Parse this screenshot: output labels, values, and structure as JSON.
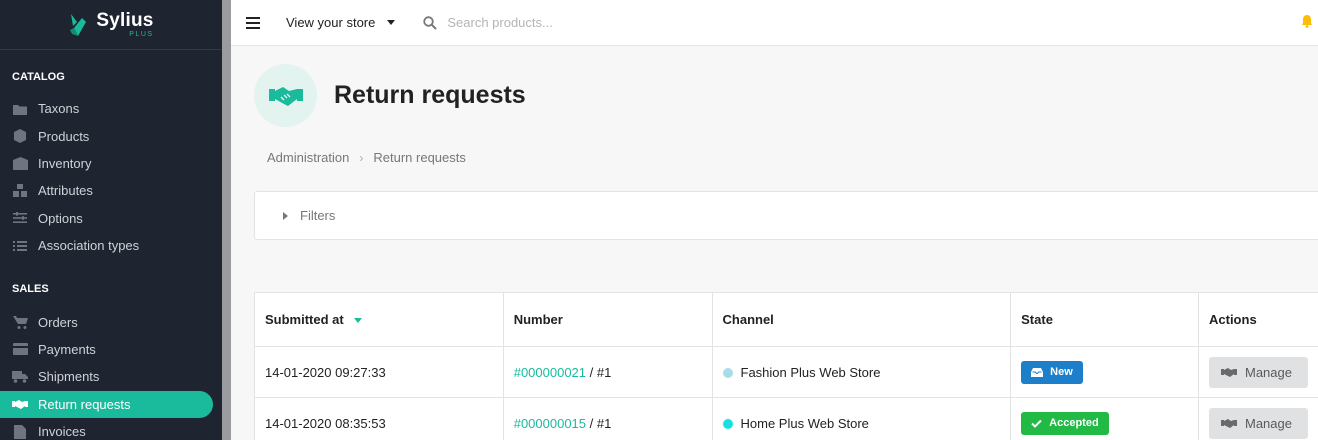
{
  "brand": {
    "name": "Sylius",
    "sub": "PLUS",
    "accent": "#1abb9c"
  },
  "sidebar": {
    "sections": [
      {
        "title": "CATALOG",
        "items": [
          {
            "label": "Taxons",
            "icon": "folder-icon"
          },
          {
            "label": "Products",
            "icon": "cube-icon"
          },
          {
            "label": "Inventory",
            "icon": "inventory-icon"
          },
          {
            "label": "Attributes",
            "icon": "cubes-icon"
          },
          {
            "label": "Options",
            "icon": "options-icon"
          },
          {
            "label": "Association types",
            "icon": "list-icon"
          }
        ]
      },
      {
        "title": "SALES",
        "items": [
          {
            "label": "Orders",
            "icon": "cart-icon"
          },
          {
            "label": "Payments",
            "icon": "payment-icon"
          },
          {
            "label": "Shipments",
            "icon": "truck-icon"
          },
          {
            "label": "Return requests",
            "icon": "handshake-icon",
            "active": true
          },
          {
            "label": "Invoices",
            "icon": "file-icon"
          }
        ]
      }
    ]
  },
  "topbar": {
    "store_label": "View your store",
    "search_placeholder": "Search products..."
  },
  "header": {
    "title": "Return requests",
    "breadcrumb": [
      "Administration",
      "Return requests"
    ]
  },
  "filters": {
    "label": "Filters"
  },
  "table": {
    "columns": [
      "Submitted at",
      "Number",
      "Channel",
      "State",
      "Actions"
    ],
    "rows": [
      {
        "submitted_at": "14-01-2020 09:27:33",
        "order_number": "#000000021",
        "return_suffix": " / #1",
        "channel": "Fashion Plus Web Store",
        "channel_color": "#a7dde8",
        "state": "New",
        "state_color": "#1d7fc9",
        "action": "Manage"
      },
      {
        "submitted_at": "14-01-2020 08:35:53",
        "order_number": "#000000015",
        "return_suffix": " / #1",
        "channel": "Home Plus Web Store",
        "channel_color": "#17e0e0",
        "state": "Accepted",
        "state_color": "#21ba45",
        "action": "Manage"
      }
    ]
  }
}
